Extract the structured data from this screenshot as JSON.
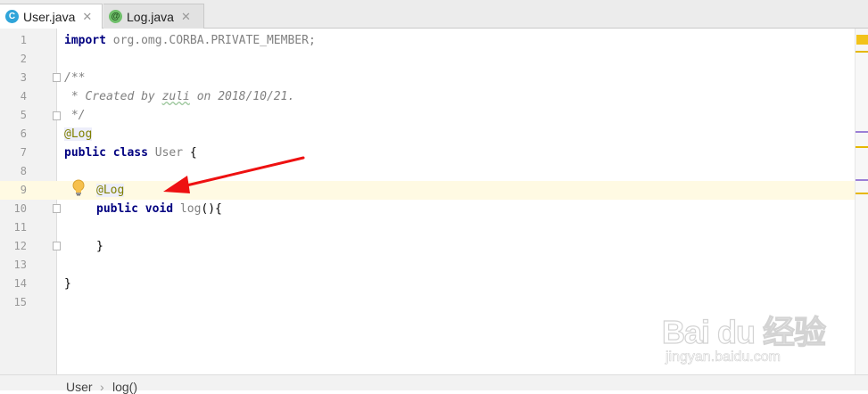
{
  "tabs": [
    {
      "label": "User.java",
      "icon": "class-icon",
      "icon_glyph": "C",
      "active": true
    },
    {
      "label": "Log.java",
      "icon": "annotation-icon",
      "icon_glyph": "@",
      "active": false
    }
  ],
  "close_glyph": "✕",
  "line_numbers": [
    "1",
    "2",
    "3",
    "4",
    "5",
    "6",
    "7",
    "8",
    "9",
    "10",
    "11",
    "12",
    "13",
    "14",
    "15"
  ],
  "code": {
    "l1_kw": "import",
    "l1_rest": " org.omg.CORBA.PRIVATE_MEMBER;",
    "l3": "/**",
    "l4_pre": " * Created by ",
    "l4_name": "zuli",
    "l4_post": " on 2018/10/21.",
    "l5": " */",
    "l6_anno": "@Log",
    "l7_kw": "public class",
    "l7_name": " User",
    "l7_brace": " {",
    "l9_anno": "@Log",
    "l10_kw": "public void",
    "l10_name": " log",
    "l10_rest": "(){",
    "l12": "}",
    "l14": "}"
  },
  "breadcrumb": [
    "User",
    "log()"
  ],
  "breadcrumb_sep": "›",
  "watermark": {
    "brand": "Bai du 经验",
    "url": "jingyan.baidu.com"
  },
  "colors": {
    "keyword": "#000080",
    "annotation": "#808000",
    "comment": "#808080",
    "current_line": "#fffae3",
    "arrow": "#ee1111"
  }
}
